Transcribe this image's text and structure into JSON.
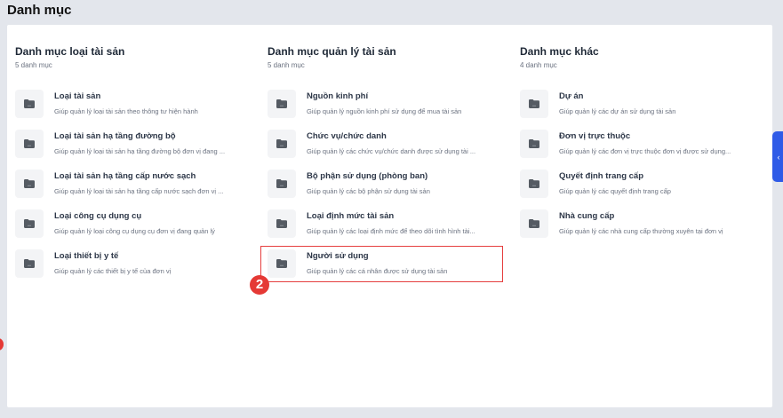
{
  "page_title": "Danh mục",
  "columns": [
    {
      "title": "Danh mục loại tài sản",
      "count": "5 danh mục",
      "items": [
        {
          "title": "Loại tài sản",
          "desc": "Giúp quản lý loại tài sản theo thông tư hiện hành"
        },
        {
          "title": "Loại tài sản hạ tầng đường bộ",
          "desc": "Giúp quản lý loại tài sản hạ tầng đường bộ đơn vị đang ..."
        },
        {
          "title": "Loại tài sản hạ tầng cấp nước sạch",
          "desc": "Giúp quản lý loại tài sản hạ tầng cấp nước sạch đơn vị ..."
        },
        {
          "title": "Loại công cụ dụng cụ",
          "desc": "Giúp quản lý loại công cụ dụng cụ đơn vị đang quản lý"
        },
        {
          "title": "Loại thiết bị y tế",
          "desc": "Giúp quản lý các thiết bị y tế của đơn vị"
        }
      ]
    },
    {
      "title": "Danh mục quản lý tài sản",
      "count": "5 danh mục",
      "items": [
        {
          "title": "Nguồn kinh phí",
          "desc": "Giúp quản lý nguồn kinh phí sử dụng để mua tài sản"
        },
        {
          "title": "Chức vụ/chức danh",
          "desc": "Giúp quản lý các chức vụ/chức danh được sử dụng tài ..."
        },
        {
          "title": "Bộ phận sử dụng (phòng ban)",
          "desc": "Giúp quản lý các bộ phận sử dụng tài sản"
        },
        {
          "title": "Loại định mức tài sản",
          "desc": "Giúp quản lý các loại định mức để theo dõi tình hình tài..."
        },
        {
          "title": "Người sử dụng",
          "desc": "Giúp quản lý các cá nhân được sử dụng tài sản"
        }
      ]
    },
    {
      "title": "Danh mục khác",
      "count": "4 danh mục",
      "items": [
        {
          "title": "Dự án",
          "desc": "Giúp quản lý các dự án sử dụng tài sản"
        },
        {
          "title": "Đơn vị trực thuộc",
          "desc": "Giúp quản lý các đơn vị trực thuộc đơn vị được sử dụng..."
        },
        {
          "title": "Quyết định trang cấp",
          "desc": "Giúp quản lý các quyết định trang cấp"
        },
        {
          "title": "Nhà cung cấp",
          "desc": "Giúp quản lý các nhà cung cấp thường xuyên tại đơn vị"
        }
      ]
    }
  ],
  "annotation_badge": "2",
  "side_tab_icon": "chevron-left-icon",
  "side_tab_glyph": "‹",
  "icon": "folder-icon",
  "colors": {
    "accent": "#2f5be7",
    "highlight": "#e53e3e"
  }
}
